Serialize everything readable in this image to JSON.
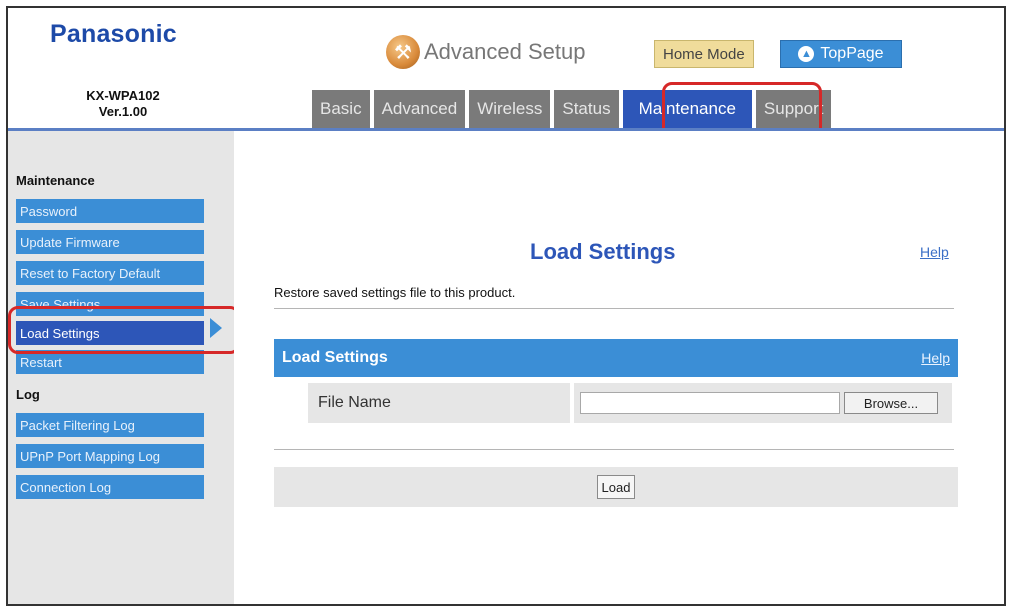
{
  "header": {
    "brand": "Panasonic",
    "model": "KX-WPA102",
    "version": "Ver.1.00",
    "setup_title": "Advanced Setup",
    "home_mode_label": "Home Mode",
    "toppage_label": "TopPage"
  },
  "tabs": [
    {
      "label": "Basic",
      "active": false
    },
    {
      "label": "Advanced",
      "active": false
    },
    {
      "label": "Wireless",
      "active": false
    },
    {
      "label": "Status",
      "active": false
    },
    {
      "label": "Maintenance",
      "active": true
    },
    {
      "label": "Support",
      "active": false
    }
  ],
  "sidebar": {
    "maintenance_heading": "Maintenance",
    "maintenance_items": [
      {
        "label": "Password"
      },
      {
        "label": "Update Firmware"
      },
      {
        "label": "Reset to Factory Default"
      },
      {
        "label": "Save Settings"
      },
      {
        "label": "Load Settings",
        "active": true
      },
      {
        "label": "Restart"
      }
    ],
    "log_heading": "Log",
    "log_items": [
      {
        "label": "Packet Filtering Log"
      },
      {
        "label": "UPnP Port Mapping Log"
      },
      {
        "label": "Connection Log"
      }
    ]
  },
  "main": {
    "title": "Load Settings",
    "help_label": "Help",
    "description": "Restore saved settings file to this product.",
    "section_title": "Load Settings",
    "section_help": "Help",
    "file_label": "File Name",
    "file_value": "",
    "browse_label": "Browse...",
    "load_label": "Load"
  },
  "colors": {
    "brand_blue": "#1d4aa8",
    "tab_active": "#2d56b8",
    "sidebar_item": "#3b8ed6",
    "highlight_red": "#d62828"
  }
}
